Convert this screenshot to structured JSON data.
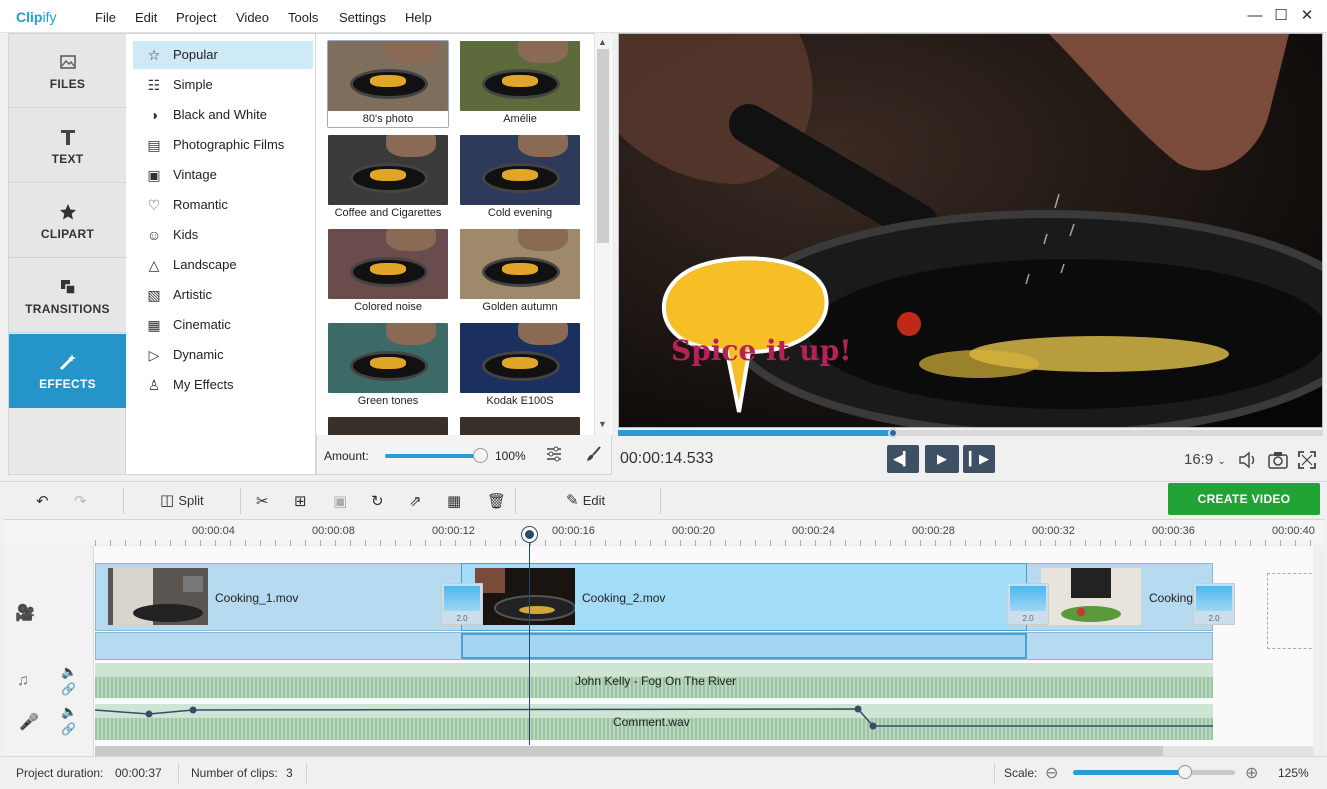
{
  "app": {
    "logo_strong": "Clip",
    "logo_rest": "ify"
  },
  "menu": [
    "File",
    "Edit",
    "Project",
    "Video",
    "Tools",
    "Settings",
    "Help"
  ],
  "window_controls": {
    "minimize": "—",
    "maximize": "☐",
    "close": "✕"
  },
  "nav": [
    {
      "label": "FILES",
      "icon": "image-icon"
    },
    {
      "label": "TEXT",
      "icon": "text-icon"
    },
    {
      "label": "CLIPART",
      "icon": "star-icon"
    },
    {
      "label": "TRANSITIONS",
      "icon": "transitions-icon"
    },
    {
      "label": "EFFECTS",
      "icon": "magic-wand-icon",
      "active": true
    }
  ],
  "categories": [
    {
      "label": "Popular",
      "icon": "☆",
      "active": true
    },
    {
      "label": "Simple",
      "icon": "☷"
    },
    {
      "label": "Black and White",
      "icon": "◑"
    },
    {
      "label": "Photographic Films",
      "icon": "▤"
    },
    {
      "label": "Vintage",
      "icon": "▣"
    },
    {
      "label": "Romantic",
      "icon": "♡"
    },
    {
      "label": "Kids",
      "icon": "☺"
    },
    {
      "label": "Landscape",
      "icon": "△"
    },
    {
      "label": "Artistic",
      "icon": "▧"
    },
    {
      "label": "Cinematic",
      "icon": "▦"
    },
    {
      "label": "Dynamic",
      "icon": "▷"
    },
    {
      "label": "My Effects",
      "icon": "♙"
    }
  ],
  "effects": [
    {
      "label": "80's photo",
      "tint": "#7d6f5c",
      "selected": true
    },
    {
      "label": "Amélie",
      "tint": "#5c6a3c"
    },
    {
      "label": "Coffee and Cigarettes",
      "tint": "#3a3a3a"
    },
    {
      "label": "Cold evening",
      "tint": "#2e3a5a"
    },
    {
      "label": "Colored noise",
      "tint": "#6a4c4c"
    },
    {
      "label": "Golden autumn",
      "tint": "#9e8a6a"
    },
    {
      "label": "Green tones",
      "tint": "#3c6a66"
    },
    {
      "label": "Kodak E100S",
      "tint": "#1c3060"
    }
  ],
  "amount": {
    "label": "Amount:",
    "value": "100%",
    "level_percent": 100
  },
  "preview": {
    "caption": "Spice it up!",
    "time": "00:00:14.533",
    "progress_fraction": 0.39,
    "aspect": "16:9"
  },
  "toolbar": {
    "split": "Split",
    "edit": "Edit",
    "create": "CREATE VIDEO"
  },
  "ruler": [
    "00:00:04",
    "00:00:08",
    "00:00:12",
    "00:00:16",
    "00:00:20",
    "00:00:24",
    "00:00:28",
    "00:00:32",
    "00:00:36",
    "00:00:40"
  ],
  "clips": [
    {
      "name": "Cooking_1.mov"
    },
    {
      "name": "Cooking_2.mov"
    },
    {
      "name": "Cooking"
    }
  ],
  "transitions": [
    "2.0",
    "2.0",
    "2.0"
  ],
  "audio": {
    "music": "John Kelly - Fog On The River",
    "voice": "Comment.wav"
  },
  "status": {
    "duration_label": "Project duration:",
    "duration": "00:00:37",
    "clips_label": "Number of clips:",
    "clips": "3",
    "scale_label": "Scale:",
    "scale": "125%",
    "scale_fraction": 0.69
  }
}
